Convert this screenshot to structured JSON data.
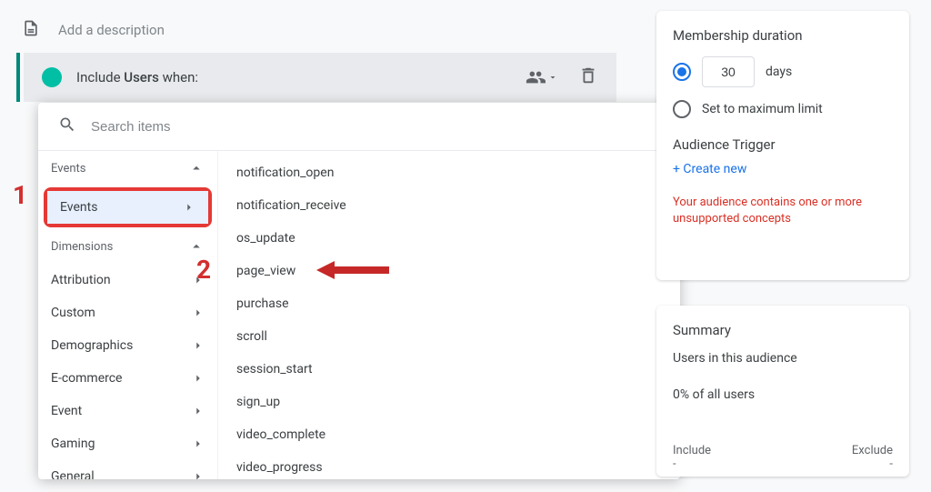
{
  "header": {
    "description_placeholder": "Add a description"
  },
  "include": {
    "prefix": "Include ",
    "subject": "Users",
    "suffix": " when:"
  },
  "dropdown": {
    "search_placeholder": "Search items",
    "groups": {
      "events": "Events",
      "events_item": "Events",
      "dimensions": "Dimensions"
    },
    "dimension_items": [
      "Attribution",
      "Custom",
      "Demographics",
      "E-commerce",
      "Event",
      "Gaming",
      "General"
    ],
    "events": [
      "notification_open",
      "notification_receive",
      "os_update",
      "page_view",
      "purchase",
      "scroll",
      "session_start",
      "sign_up",
      "video_complete",
      "video_progress"
    ]
  },
  "membership": {
    "title": "Membership duration",
    "days_value": "30",
    "days_label": "days",
    "max_limit": "Set to maximum limit",
    "trigger_title": "Audience Trigger",
    "create_new": "+ Create new",
    "warning": "Your audience contains one or more unsupported concepts"
  },
  "summary": {
    "title": "Summary",
    "line": "Users in this audience",
    "percent": "0% of all users",
    "include_label": "Include",
    "exclude_label": "Exclude",
    "dash": "-"
  },
  "annotations": {
    "one": "1",
    "two": "2"
  }
}
